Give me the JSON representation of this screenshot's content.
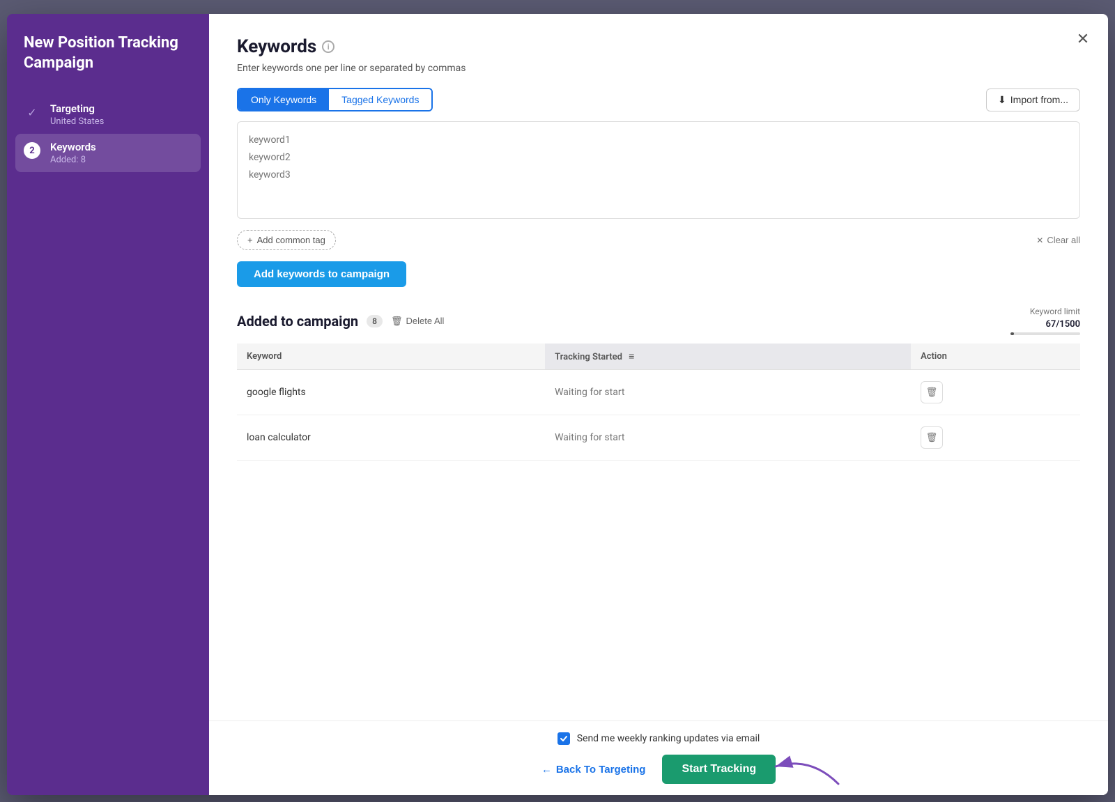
{
  "sidebar": {
    "title": "New Position Tracking Campaign",
    "steps": [
      {
        "id": "targeting",
        "label": "Targeting",
        "sublabel": "United States",
        "state": "completed",
        "number": null
      },
      {
        "id": "keywords",
        "label": "Keywords",
        "sublabel": "Added: 8",
        "state": "active",
        "number": "2"
      }
    ]
  },
  "modal": {
    "title": "Keywords",
    "subtitle": "Enter keywords one per line or separated by commas",
    "close_label": "×",
    "tabs": [
      {
        "id": "only-keywords",
        "label": "Only Keywords",
        "active": true
      },
      {
        "id": "tagged-keywords",
        "label": "Tagged Keywords",
        "active": false
      }
    ],
    "import_label": "Import from...",
    "textarea_placeholder": "keyword1\nkeyword2\nkeyword3",
    "add_tag_label": "+ Add common tag",
    "clear_all_label": "Clear all",
    "add_keywords_btn_label": "Add keywords to campaign",
    "added_section": {
      "title": "Added to campaign",
      "count": "8",
      "delete_all_label": "Delete All",
      "keyword_limit_label": "Keyword limit",
      "keyword_limit_value": "67/1500",
      "limit_percent": 4.5
    },
    "table": {
      "headers": [
        "Keyword",
        "Tracking Started",
        "Action"
      ],
      "rows": [
        {
          "keyword": "google flights",
          "status": "Waiting for start"
        },
        {
          "keyword": "loan calculator",
          "status": "Waiting for start"
        }
      ]
    },
    "footer": {
      "checkbox_label": "Send me weekly ranking updates via email",
      "back_label": "Back To Targeting",
      "start_label": "Start Tracking"
    }
  },
  "icons": {
    "check": "✓",
    "close": "✕",
    "import": "⬇",
    "plus": "+",
    "x_clear": "✕",
    "trash": "🗑",
    "sort": "≡",
    "arrow_left": "←",
    "checkmark_white": "✓"
  }
}
